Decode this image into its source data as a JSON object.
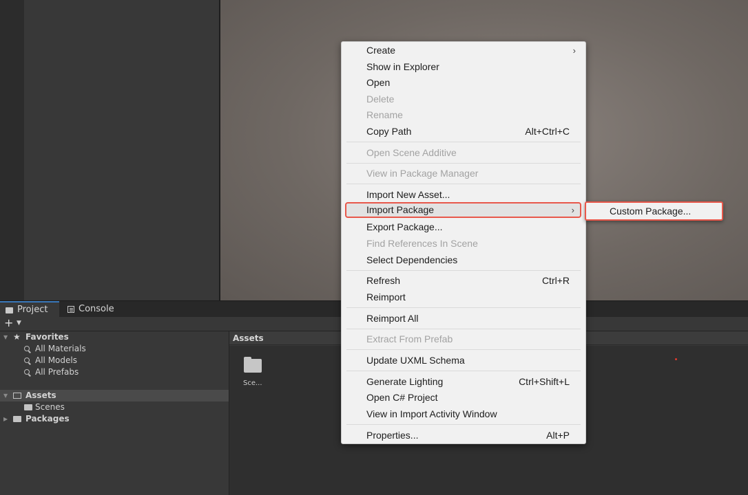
{
  "tabs": {
    "project": "Project",
    "console": "Console"
  },
  "toolbar": {
    "add": "+"
  },
  "tree": {
    "favorites": "Favorites",
    "all_materials": "All Materials",
    "all_models": "All Models",
    "all_prefabs": "All Prefabs",
    "assets": "Assets",
    "scenes": "Scenes",
    "packages": "Packages"
  },
  "assets_panel": {
    "header": "Assets",
    "folder_caption": "Sce..."
  },
  "context_menu": {
    "create": "Create",
    "show_in_explorer": "Show in Explorer",
    "open": "Open",
    "delete": "Delete",
    "rename": "Rename",
    "copy_path": "Copy Path",
    "copy_path_shortcut": "Alt+Ctrl+C",
    "open_scene_additive": "Open Scene Additive",
    "view_in_package_manager": "View in Package Manager",
    "import_new_asset": "Import New Asset...",
    "import_package": "Import Package",
    "export_package": "Export Package...",
    "find_references": "Find References In Scene",
    "select_dependencies": "Select Dependencies",
    "refresh": "Refresh",
    "refresh_shortcut": "Ctrl+R",
    "reimport": "Reimport",
    "reimport_all": "Reimport All",
    "extract_from_prefab": "Extract From Prefab",
    "update_uxml": "Update UXML Schema",
    "generate_lighting": "Generate Lighting",
    "generate_lighting_shortcut": "Ctrl+Shift+L",
    "open_csharp": "Open C# Project",
    "view_import_activity": "View in Import Activity Window",
    "properties": "Properties...",
    "properties_shortcut": "Alt+P",
    "arrow": "›"
  },
  "submenu": {
    "custom_package": "Custom Package..."
  },
  "colors": {
    "highlight_border": "#e8574a",
    "menu_bg": "#f1f1f1",
    "editor_bg": "#383838"
  }
}
